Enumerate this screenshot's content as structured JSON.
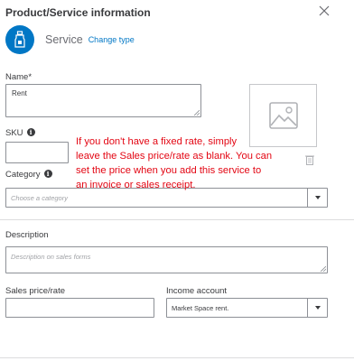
{
  "header": {
    "title": "Product/Service information"
  },
  "item_type": {
    "name": "Service",
    "change_link": "Change type",
    "icon": "service-bell-icon"
  },
  "form": {
    "name_label": "Name*",
    "name_value": "Rent",
    "sku_label": "SKU",
    "category_label": "Category",
    "category_placeholder": "Choose a category",
    "description_label": "Description",
    "description_placeholder": "Description on sales forms",
    "sales_price_label": "Sales price/rate",
    "sales_price_value": "",
    "income_account_label": "Income account",
    "income_account_value": "Market Space rent."
  },
  "tooltip": {
    "lines": [
      "If you don't have a fixed rate, simply",
      "leave the Sales price/rate as blank. You can",
      "set the price when you add this service to",
      "an invoice or sales receipt."
    ]
  },
  "colors": {
    "accent": "#0077c5",
    "annotation": "#e30613"
  }
}
